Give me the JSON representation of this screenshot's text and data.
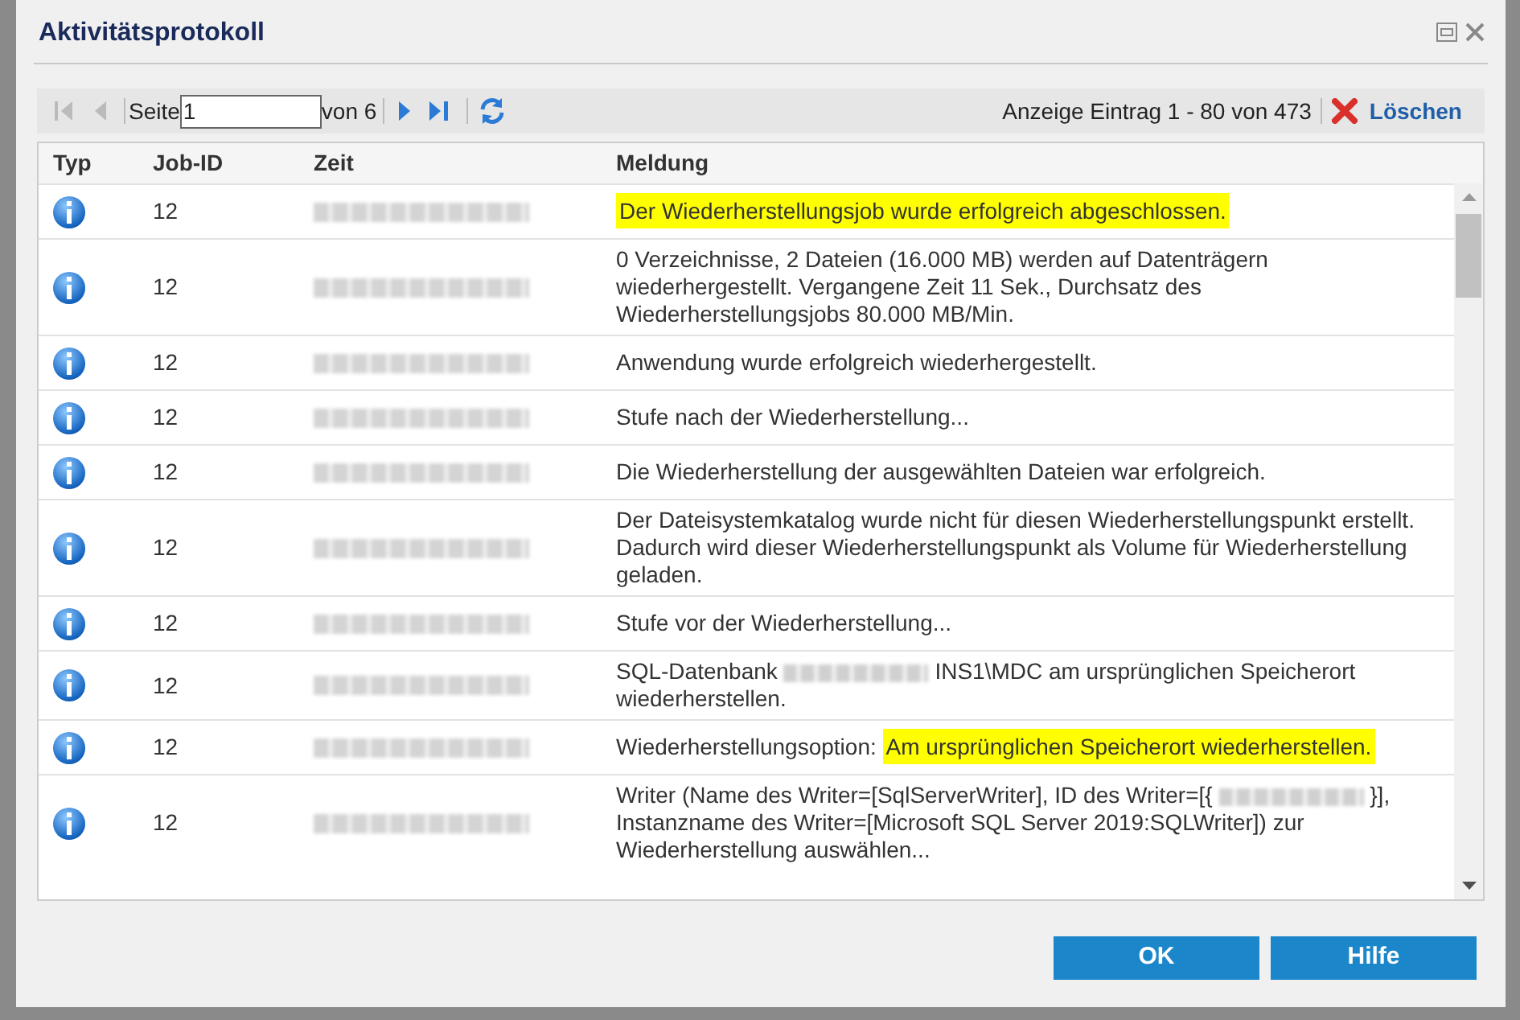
{
  "window": {
    "title": "Aktivitätsprotokoll"
  },
  "toolbar": {
    "page_label": "Seite",
    "page_value": "1",
    "page_total": "von 6",
    "summary": "Anzeige Eintrag 1 - 80 von 473",
    "delete_label": "Löschen"
  },
  "table": {
    "columns": [
      "Typ",
      "Job-ID",
      "Zeit",
      "Meldung"
    ],
    "rows": [
      {
        "job_id": "12",
        "message": [
          {
            "kind": "text",
            "text": "Der Wiederherstellungsjob wurde erfolgreich abgeschlossen.",
            "highlighted": true
          }
        ]
      },
      {
        "job_id": "12",
        "message": [
          {
            "kind": "text",
            "text": "0 Verzeichnisse, 2 Dateien (16.000 MB) werden auf Datenträgern wiederhergestellt. Vergangene Zeit 11 Sek., Durchsatz des Wiederherstellungsjobs 80.000 MB/Min.",
            "highlighted": false
          }
        ]
      },
      {
        "job_id": "12",
        "message": [
          {
            "kind": "text",
            "text": "Anwendung wurde erfolgreich wiederhergestellt.",
            "highlighted": false
          }
        ]
      },
      {
        "job_id": "12",
        "message": [
          {
            "kind": "text",
            "text": "Stufe nach der Wiederherstellung...",
            "highlighted": false
          }
        ]
      },
      {
        "job_id": "12",
        "message": [
          {
            "kind": "text",
            "text": "Die Wiederherstellung der ausgewählten Dateien war erfolgreich.",
            "highlighted": false
          }
        ]
      },
      {
        "job_id": "12",
        "message": [
          {
            "kind": "text",
            "text": "Der Dateisystemkatalog wurde nicht für diesen Wiederherstellungspunkt erstellt. Dadurch wird dieser Wiederherstellungspunkt als Volume für Wiederherstellung geladen.",
            "highlighted": false
          }
        ]
      },
      {
        "job_id": "12",
        "message": [
          {
            "kind": "text",
            "text": "Stufe vor der Wiederherstellung...",
            "highlighted": false
          }
        ]
      },
      {
        "job_id": "12",
        "message": [
          {
            "kind": "text",
            "text": "SQL-Datenbank",
            "highlighted": false
          },
          {
            "kind": "redacted"
          },
          {
            "kind": "text",
            "text": "INS1\\MDC am ursprünglichen Speicherort wiederherstellen.",
            "highlighted": false
          }
        ]
      },
      {
        "job_id": "12",
        "message": [
          {
            "kind": "text",
            "text": "Wiederherstellungsoption:",
            "highlighted": false
          },
          {
            "kind": "text",
            "text": "Am ursprünglichen Speicherort wiederherstellen.",
            "highlighted": true
          }
        ]
      },
      {
        "job_id": "12",
        "message": [
          {
            "kind": "text",
            "text": "Writer (Name des Writer=[SqlServerWriter], ID des Writer=[{",
            "highlighted": false
          },
          {
            "kind": "redacted"
          },
          {
            "kind": "text",
            "text": "}], Instanzname des Writer=[Microsoft SQL Server 2019:SQLWriter]) zur Wiederherstellung auswählen...",
            "highlighted": false
          }
        ]
      }
    ]
  },
  "buttons": [
    {
      "label": "OK"
    },
    {
      "label": "Hilfe"
    }
  ]
}
